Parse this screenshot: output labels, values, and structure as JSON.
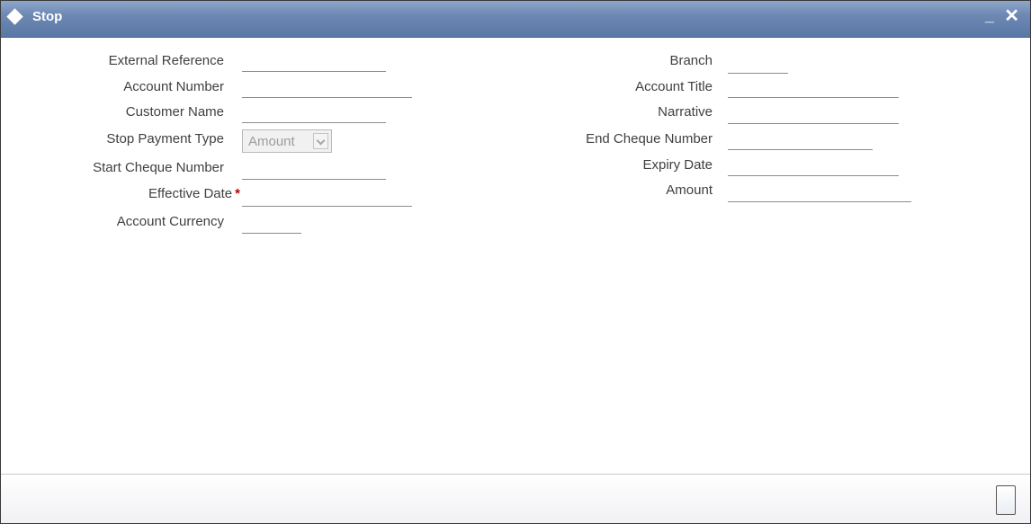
{
  "window": {
    "title": "Stop",
    "minimize_label": "_",
    "close_label": "✕"
  },
  "form": {
    "left": {
      "external_reference": {
        "label": "External Reference",
        "value": ""
      },
      "account_number": {
        "label": "Account Number",
        "value": ""
      },
      "customer_name": {
        "label": "Customer Name",
        "value": ""
      },
      "stop_payment_type": {
        "label": "Stop Payment Type",
        "value": "Amount",
        "options": [
          "Amount"
        ]
      },
      "start_cheque_number": {
        "label": "Start Cheque Number",
        "value": ""
      },
      "effective_date": {
        "label": "Effective Date",
        "required_marker": "*",
        "value": ""
      },
      "account_currency": {
        "label": "Account Currency",
        "value": ""
      }
    },
    "right": {
      "branch": {
        "label": "Branch",
        "value": ""
      },
      "account_title": {
        "label": "Account Title",
        "value": ""
      },
      "narrative": {
        "label": "Narrative",
        "value": ""
      },
      "end_cheque_number": {
        "label": "End Cheque Number",
        "value": ""
      },
      "expiry_date": {
        "label": "Expiry Date",
        "value": ""
      },
      "amount": {
        "label": "Amount",
        "value": ""
      }
    }
  },
  "icons": {
    "title": "diamond-icon",
    "minimize": "minimize-icon",
    "close": "close-icon",
    "dropdown": "chevron-down-icon"
  },
  "colors": {
    "titlebar": "#6d88b3",
    "required": "#c00000",
    "label": "#404040"
  }
}
